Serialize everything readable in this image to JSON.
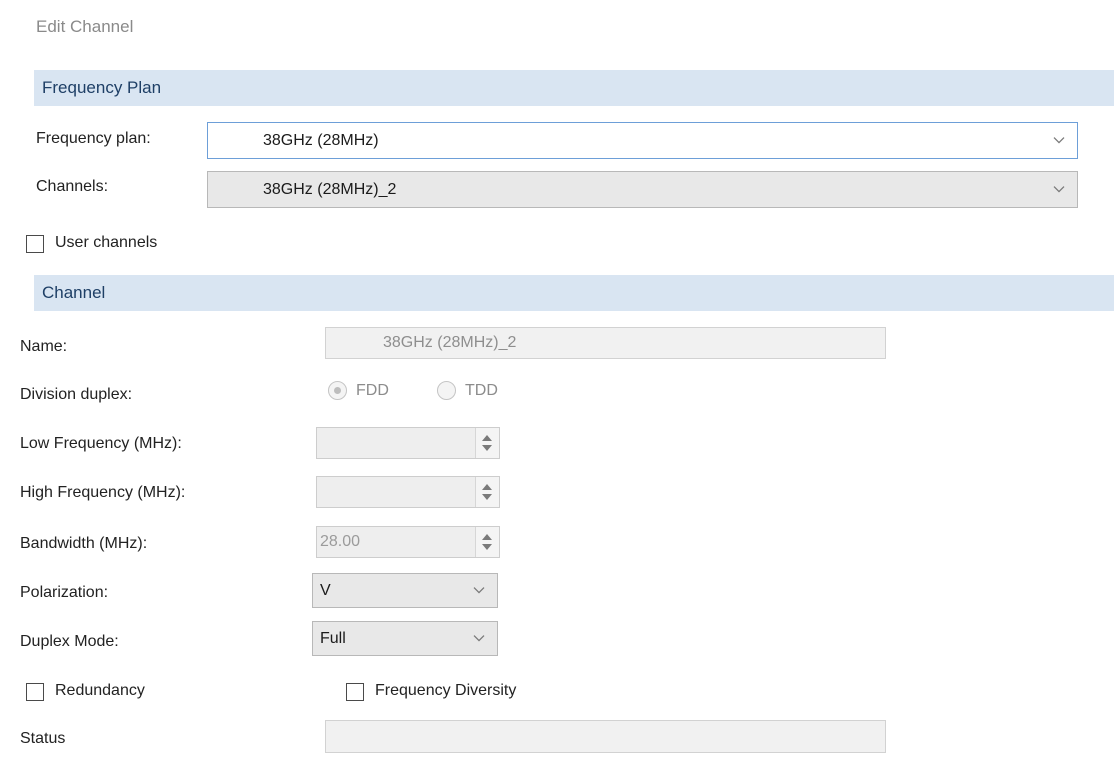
{
  "dialog": {
    "title": "Edit Channel"
  },
  "frequency_plan_section": {
    "header": "Frequency Plan",
    "frequency_plan_label": "Frequency plan:",
    "frequency_plan_value": "38GHz (28MHz)",
    "channels_label": "Channels:",
    "channels_value": "38GHz (28MHz)_2",
    "user_channels_label": "User channels",
    "user_channels_checked": false
  },
  "channel_section": {
    "header": "Channel",
    "name_label": "Name:",
    "name_value": "38GHz (28MHz)_2",
    "division_duplex_label": "Division duplex:",
    "fdd_label": "FDD",
    "tdd_label": "TDD",
    "division_duplex_selected": "FDD",
    "low_frequency_label": "Low Frequency (MHz):",
    "low_frequency_value": "",
    "high_frequency_label": "High Frequency (MHz):",
    "high_frequency_value": "",
    "bandwidth_label": "Bandwidth (MHz):",
    "bandwidth_value": "28.00",
    "polarization_label": "Polarization:",
    "polarization_value": "V",
    "duplex_mode_label": "Duplex Mode:",
    "duplex_mode_value": "Full",
    "redundancy_label": "Redundancy",
    "redundancy_checked": false,
    "frequency_diversity_label": "Frequency Diversity",
    "frequency_diversity_checked": false,
    "status_label": "Status",
    "status_value": ""
  },
  "icons": {
    "dropdown": "chevron-down-icon",
    "spinner": "spin-arrows-icon",
    "checkbox": "checkbox-icon",
    "radio": "radio-icon"
  },
  "colors": {
    "section_header_bg": "#d9e5f2",
    "section_header_text": "#1e3f66",
    "focus_border": "#6d9fd8"
  }
}
